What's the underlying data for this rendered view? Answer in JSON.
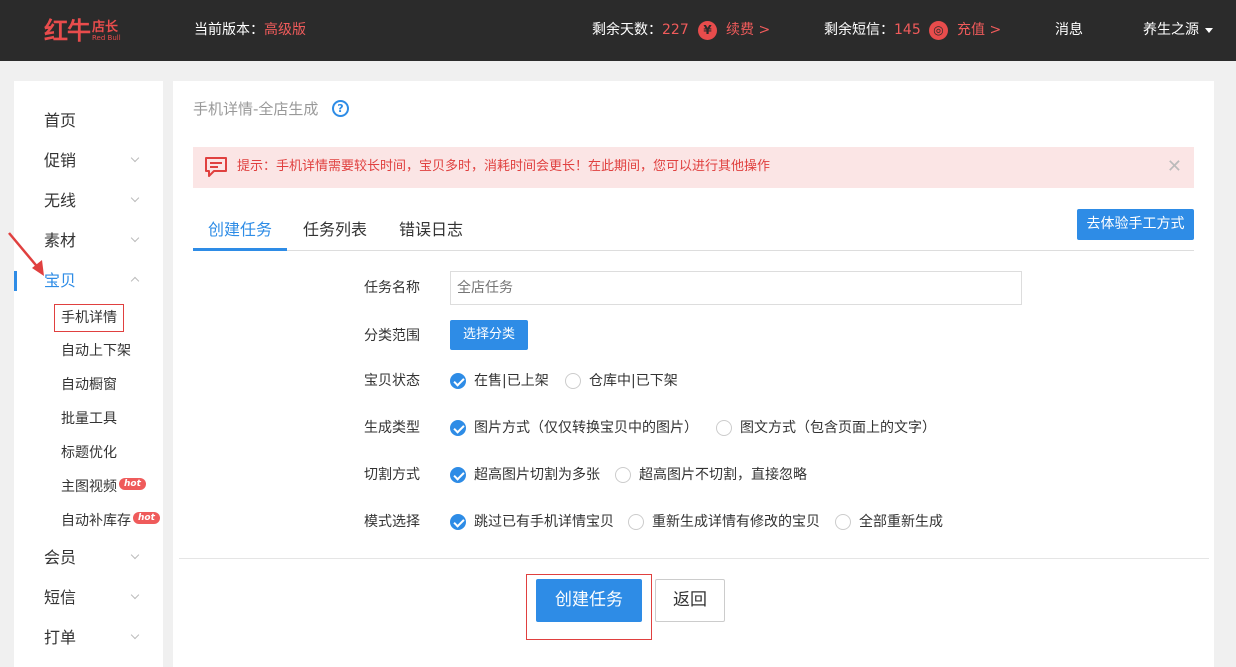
{
  "header": {
    "logo_main": "红牛",
    "logo_side": "店长",
    "logo_en": "Red Bull",
    "version_label": "当前版本：",
    "version_value": "高级版",
    "days_label": "剩余天数：",
    "days_value": "227",
    "days_icon_glyph": "¥",
    "renew_link": "续费 >",
    "sms_label": "剩余短信：",
    "sms_value": "145",
    "sms_icon_glyph": "◎",
    "recharge_link": "充值 >",
    "messages": "消息",
    "user_name": "养生之源"
  },
  "sidebar": {
    "items": [
      {
        "label": "首页"
      },
      {
        "label": "促销"
      },
      {
        "label": "无线"
      },
      {
        "label": "素材"
      },
      {
        "label": "宝贝"
      },
      {
        "label": "会员"
      },
      {
        "label": "短信"
      },
      {
        "label": "打单"
      }
    ],
    "sub_items": [
      {
        "label": "手机详情"
      },
      {
        "label": "自动上下架"
      },
      {
        "label": "自动橱窗"
      },
      {
        "label": "批量工具"
      },
      {
        "label": "标题优化"
      },
      {
        "label": "主图视频",
        "badge": "hot"
      },
      {
        "label": "自动补库存",
        "badge": "hot"
      }
    ]
  },
  "main": {
    "title": "手机详情-全店生成",
    "help_glyph": "?",
    "alert_text": "提示：手机详情需要较长时间，宝贝多时，消耗时间会更长！在此期间，您可以进行其他操作",
    "alert_close": "✕",
    "tabs": [
      {
        "label": "创建任务"
      },
      {
        "label": "任务列表"
      },
      {
        "label": "错误日志"
      }
    ],
    "manual_button": "去体验手工方式",
    "form": {
      "task_name_label": "任务名称",
      "task_name_placeholder": "全店任务",
      "category_label": "分类范围",
      "category_button": "选择分类",
      "status_label": "宝贝状态",
      "status_options": [
        "在售|已上架",
        "仓库中|已下架"
      ],
      "type_label": "生成类型",
      "type_options": [
        "图片方式（仅仅转换宝贝中的图片）",
        "图文方式（包含页面上的文字）"
      ],
      "cut_label": "切割方式",
      "cut_options": [
        "超高图片切割为多张",
        "超高图片不切割，直接忽略"
      ],
      "mode_label": "模式选择",
      "mode_options": [
        "跳过已有手机详情宝贝",
        "重新生成详情有修改的宝贝",
        "全部重新生成"
      ]
    },
    "create_button": "创建任务",
    "back_button": "返回"
  },
  "colors": {
    "accent": "#2e8ce6",
    "danger": "#e0403f",
    "header_bg": "#2b2b2b"
  }
}
